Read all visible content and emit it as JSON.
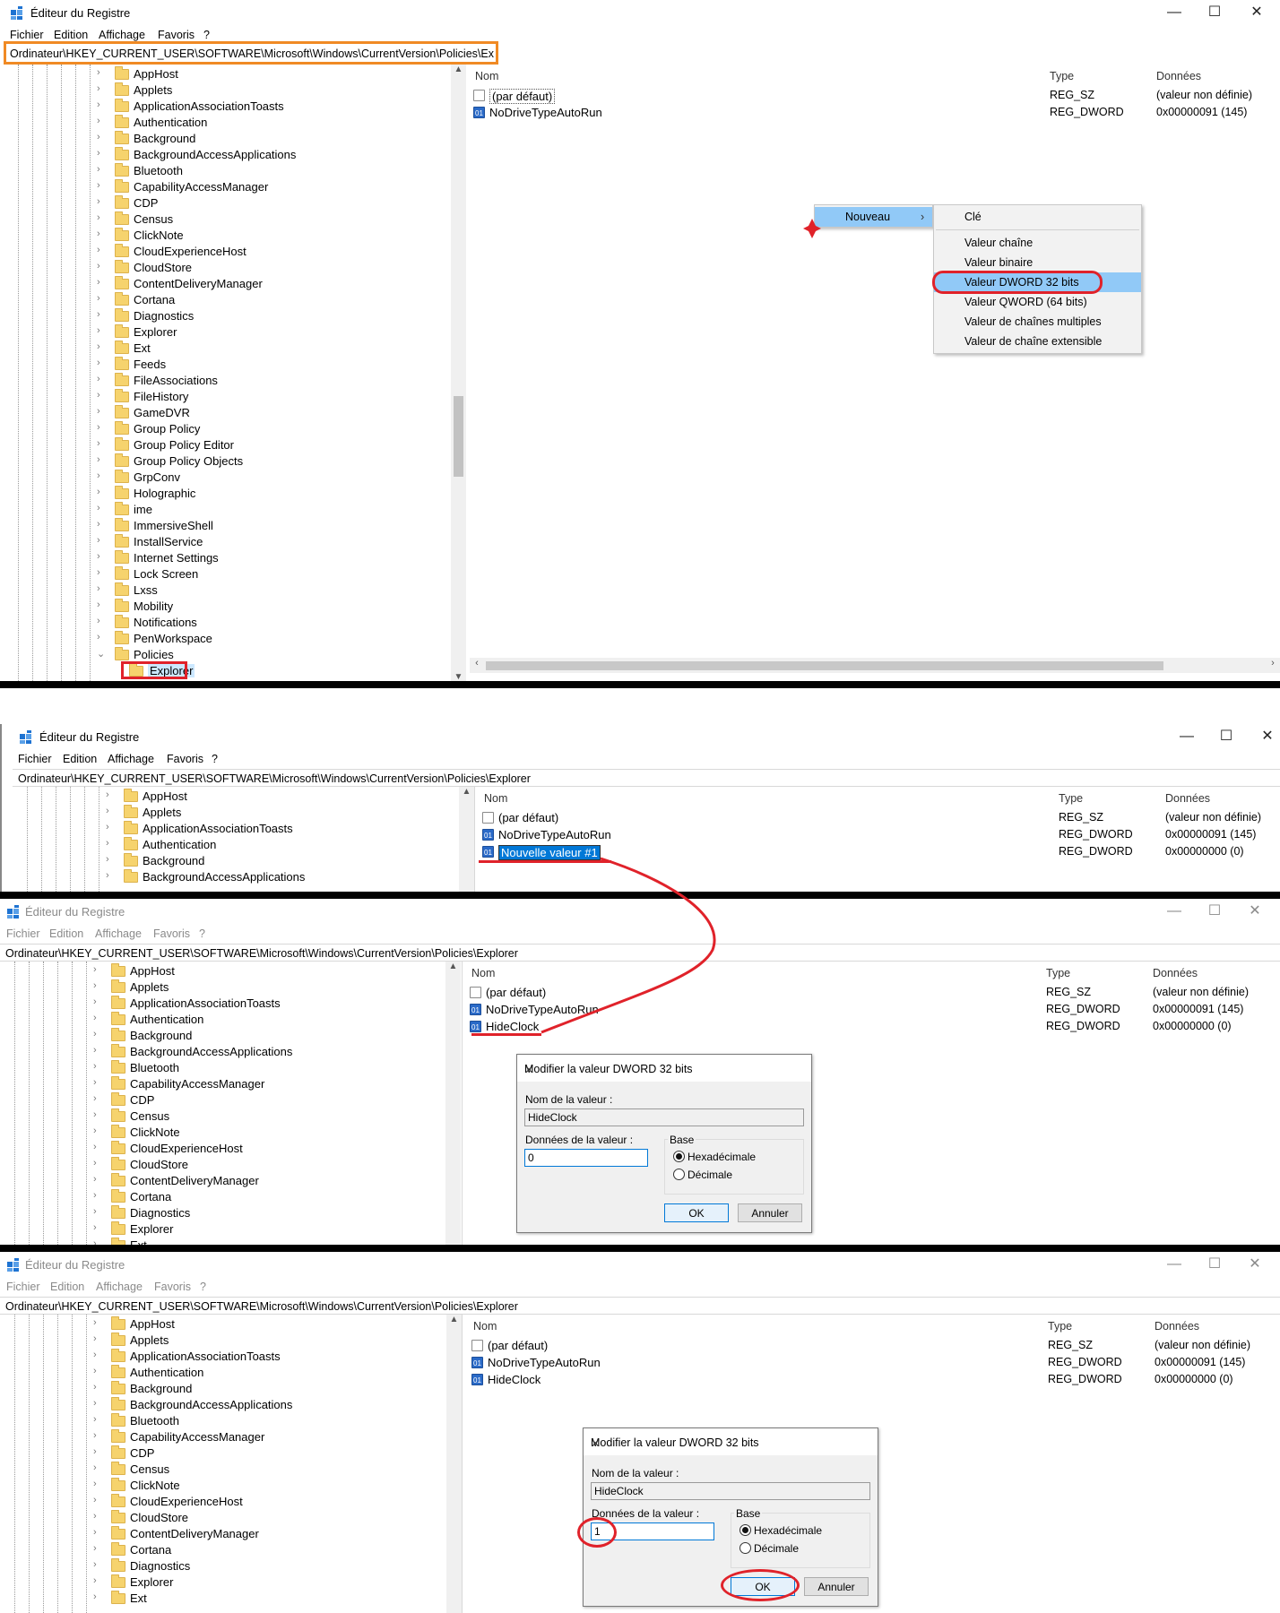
{
  "app": {
    "title": "Éditeur du Registre",
    "menu": [
      "Fichier",
      "Edition",
      "Affichage",
      "Favoris",
      "?"
    ],
    "address": "Ordinateur\\HKEY_CURRENT_USER\\SOFTWARE\\Microsoft\\Windows\\CurrentVersion\\Policies\\Explorer",
    "window_controls": {
      "minimize": "—",
      "maximize": "☐",
      "close": "✕"
    }
  },
  "tree_full": [
    "AppHost",
    "Applets",
    "ApplicationAssociationToasts",
    "Authentication",
    "Background",
    "BackgroundAccessApplications",
    "Bluetooth",
    "CapabilityAccessManager",
    "CDP",
    "Census",
    "ClickNote",
    "CloudExperienceHost",
    "CloudStore",
    "ContentDeliveryManager",
    "Cortana",
    "Diagnostics",
    "Explorer",
    "Ext",
    "Feeds",
    "FileAssociations",
    "FileHistory",
    "GameDVR",
    "Group Policy",
    "Group Policy Editor",
    "Group Policy Objects",
    "GrpConv",
    "Holographic",
    "ime",
    "ImmersiveShell",
    "InstallService",
    "Internet Settings",
    "Lock Screen",
    "Lxss",
    "Mobility",
    "Notifications",
    "PenWorkspace",
    "Policies",
    "Explorer"
  ],
  "columns": {
    "name": "Nom",
    "type": "Type",
    "data": "Données"
  },
  "values_initial": [
    {
      "name": "(par défaut)",
      "type": "REG_SZ",
      "data": "(valeur non définie)",
      "icon": "string-value-icon"
    },
    {
      "name": "NoDriveTypeAutoRun",
      "type": "REG_DWORD",
      "data": "0x00000091 (145)",
      "icon": "dword-value-icon"
    }
  ],
  "values_new": [
    {
      "name": "(par défaut)",
      "type": "REG_SZ",
      "data": "(valeur non définie)"
    },
    {
      "name": "NoDriveTypeAutoRun",
      "type": "REG_DWORD",
      "data": "0x00000091 (145)"
    },
    {
      "name": "Nouvelle valeur #1",
      "type": "REG_DWORD",
      "data": "0x00000000 (0)"
    }
  ],
  "values_renamed": [
    {
      "name": "(par défaut)",
      "type": "REG_SZ",
      "data": "(valeur non définie)"
    },
    {
      "name": "NoDriveTypeAutoRun",
      "type": "REG_DWORD",
      "data": "0x00000091 (145)"
    },
    {
      "name": "HideClock",
      "type": "REG_DWORD",
      "data": "0x00000000 (0)"
    }
  ],
  "context_menu": {
    "parent": "Nouveau",
    "items": [
      "Clé",
      "Valeur chaîne",
      "Valeur binaire",
      "Valeur DWORD 32 bits",
      "Valeur QWORD (64 bits)",
      "Valeur de chaînes multiples",
      "Valeur de chaîne extensible"
    ],
    "highlighted": "Valeur DWORD 32 bits"
  },
  "dialog": {
    "title": "Modifier la valeur DWORD 32 bits",
    "name_label": "Nom de la valeur :",
    "name_value": "HideClock",
    "data_label": "Données de la valeur :",
    "base_label": "Base",
    "hex_label": "Hexadécimale",
    "dec_label": "Décimale",
    "ok": "OK",
    "cancel": "Annuler",
    "data_before": "0",
    "data_after": "1"
  },
  "colors": {
    "address_highlight": "#f08a24",
    "annotation_red": "#e0222a",
    "menu_highlight": "#91c9f7"
  }
}
